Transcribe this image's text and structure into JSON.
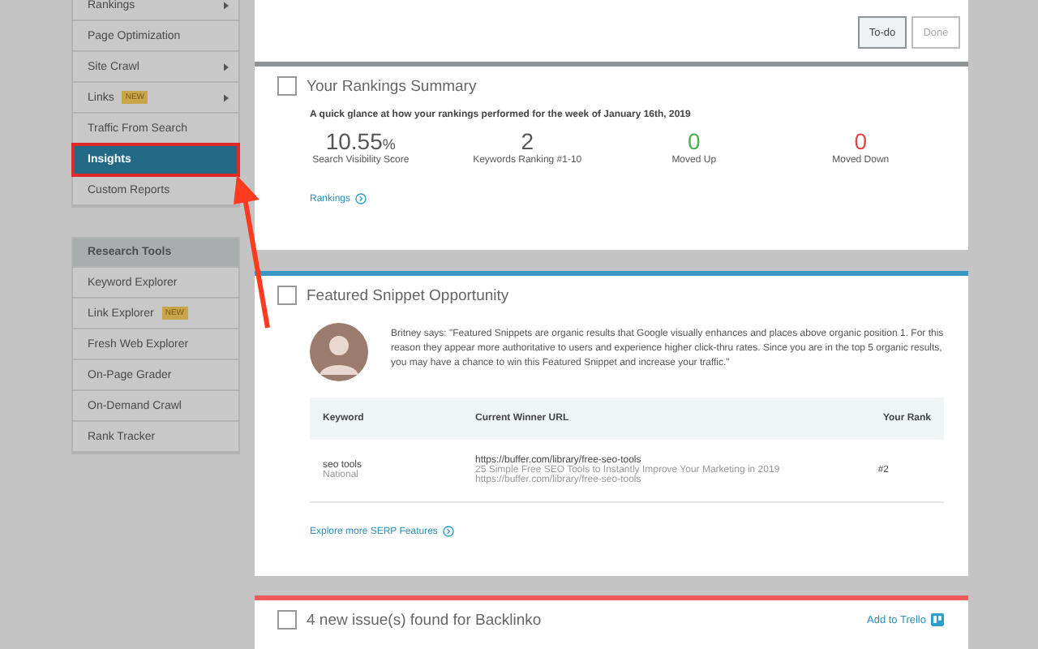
{
  "sidebar": {
    "items": [
      {
        "label": "Rankings",
        "submenu": true,
        "selected": false
      },
      {
        "label": "Page Optimization",
        "submenu": false,
        "selected": false
      },
      {
        "label": "Site Crawl",
        "submenu": true,
        "selected": false
      },
      {
        "label": "Links",
        "badge": "NEW",
        "submenu": true,
        "selected": false
      },
      {
        "label": "Traffic From Search",
        "submenu": false,
        "selected": false
      },
      {
        "label": "Insights",
        "submenu": false,
        "selected": true
      },
      {
        "label": "Custom Reports",
        "submenu": false,
        "selected": false
      }
    ],
    "research_tools": {
      "title": "Research Tools",
      "items": [
        {
          "label": "Keyword Explorer",
          "selected": false
        },
        {
          "label": "Link Explorer",
          "badge": "NEW",
          "selected": false
        },
        {
          "label": "Fresh Web Explorer",
          "selected": false
        },
        {
          "label": "On-Page Grader",
          "selected": false
        },
        {
          "label": "On-Demand Crawl",
          "selected": false
        },
        {
          "label": "Rank Tracker",
          "selected": false
        }
      ]
    }
  },
  "filter_tabs": [
    {
      "label": "To-do",
      "selected": true
    },
    {
      "label": "Done",
      "selected": false
    }
  ],
  "rankings_card": {
    "title": "Your Rankings Summary",
    "checked": false,
    "subtitle": "A quick glance at how your rankings performed for the week of January 16th, 2019",
    "stats": [
      {
        "value": "10.55",
        "unit": "%",
        "label": "Search Visibility Score",
        "kind": "neutral"
      },
      {
        "value": "2",
        "label": "Keywords Ranking #1-10",
        "kind": "neutral"
      },
      {
        "value": "0",
        "label": "Moved Up",
        "kind": "up"
      },
      {
        "value": "0",
        "label": "Moved Down",
        "kind": "down"
      }
    ],
    "link": "Rankings"
  },
  "snippet_card": {
    "title": "Featured Snippet Opportunity",
    "checked": false,
    "quote": "Britney says: \"Featured Snippets are organic results that Google visually enhances and places above organic position 1. For this reason they appear more authoritative to users and experience higher click-thru rates. Since you are in the top 5 organic results, you may have a chance to win this Featured Snippet and increase your traffic.\"",
    "table": {
      "columns": [
        "Keyword",
        "Current Winner URL",
        "Your Rank"
      ],
      "rows": [
        {
          "keyword": "seo tools",
          "location": "National",
          "url": "https://buffer.com/library/free-seo-tools",
          "page_title": "25 Simple Free SEO Tools to Instantly Improve Your Marketing in 2019",
          "page_url": "https://buffer.com/library/free-seo-tools",
          "rank": "#2"
        }
      ]
    },
    "link": "Explore more SERP Features"
  },
  "issues_card": {
    "title": "4 new issue(s) found for Backlinko",
    "checked": false,
    "action": "Add to Trello"
  }
}
